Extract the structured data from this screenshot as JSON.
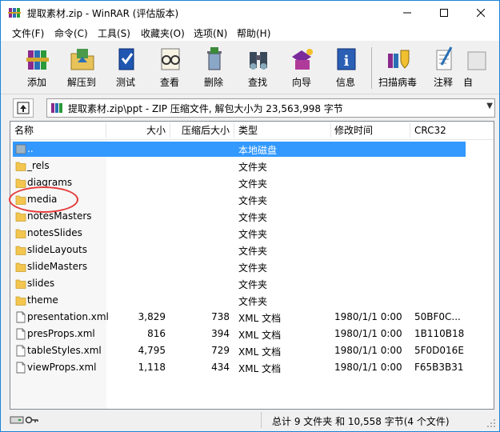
{
  "window": {
    "title": "提取素材.zip - WinRAR (评估版本)"
  },
  "menu": [
    "文件(F)",
    "命令(C)",
    "工具(S)",
    "收藏夹(O)",
    "选项(N)",
    "帮助(H)"
  ],
  "toolbar": [
    {
      "label": "添加",
      "icon": "add-books-icon"
    },
    {
      "label": "解压到",
      "icon": "extract-folder-icon"
    },
    {
      "label": "测试",
      "icon": "test-book-icon"
    },
    {
      "label": "查看",
      "icon": "view-glasses-icon"
    },
    {
      "label": "删除",
      "icon": "delete-trash-icon"
    },
    {
      "label": "查找",
      "icon": "find-binoculars-icon"
    },
    {
      "label": "向导",
      "icon": "wizard-icon"
    },
    {
      "label": "信息",
      "icon": "info-icon"
    },
    {
      "label": "扫描病毒",
      "icon": "scan-virus-icon"
    },
    {
      "label": "注释",
      "icon": "comment-icon"
    },
    {
      "label": "自",
      "icon": "sfx-icon"
    }
  ],
  "address": {
    "path": "提取素材.zip\\ppt - ZIP 压缩文件, 解包大小为 23,563,998 字节"
  },
  "columns": {
    "name": "名称",
    "size": "大小",
    "packed": "压缩后大小",
    "type": "类型",
    "modified": "修改时间",
    "crc": "CRC32"
  },
  "files": [
    {
      "name": "..",
      "size": "",
      "packed": "",
      "type": "本地磁盘",
      "modified": "",
      "crc": "",
      "kind": "drive",
      "selected": true
    },
    {
      "name": "_rels",
      "size": "",
      "packed": "",
      "type": "文件夹",
      "modified": "",
      "crc": "",
      "kind": "folder"
    },
    {
      "name": "diagrams",
      "size": "",
      "packed": "",
      "type": "文件夹",
      "modified": "",
      "crc": "",
      "kind": "folder"
    },
    {
      "name": "media",
      "size": "",
      "packed": "",
      "type": "文件夹",
      "modified": "",
      "crc": "",
      "kind": "folder"
    },
    {
      "name": "notesMasters",
      "size": "",
      "packed": "",
      "type": "文件夹",
      "modified": "",
      "crc": "",
      "kind": "folder"
    },
    {
      "name": "notesSlides",
      "size": "",
      "packed": "",
      "type": "文件夹",
      "modified": "",
      "crc": "",
      "kind": "folder"
    },
    {
      "name": "slideLayouts",
      "size": "",
      "packed": "",
      "type": "文件夹",
      "modified": "",
      "crc": "",
      "kind": "folder"
    },
    {
      "name": "slideMasters",
      "size": "",
      "packed": "",
      "type": "文件夹",
      "modified": "",
      "crc": "",
      "kind": "folder"
    },
    {
      "name": "slides",
      "size": "",
      "packed": "",
      "type": "文件夹",
      "modified": "",
      "crc": "",
      "kind": "folder"
    },
    {
      "name": "theme",
      "size": "",
      "packed": "",
      "type": "文件夹",
      "modified": "",
      "crc": "",
      "kind": "folder"
    },
    {
      "name": "presentation.xml",
      "size": "3,829",
      "packed": "738",
      "type": "XML 文档",
      "modified": "1980/1/1 0:00",
      "crc": "50BF0C...",
      "kind": "file"
    },
    {
      "name": "presProps.xml",
      "size": "816",
      "packed": "394",
      "type": "XML 文档",
      "modified": "1980/1/1 0:00",
      "crc": "1B110B18",
      "kind": "file"
    },
    {
      "name": "tableStyles.xml",
      "size": "4,795",
      "packed": "729",
      "type": "XML 文档",
      "modified": "1980/1/1 0:00",
      "crc": "5F0D016E",
      "kind": "file"
    },
    {
      "name": "viewProps.xml",
      "size": "1,118",
      "packed": "434",
      "type": "XML 文档",
      "modified": "1980/1/1 0:00",
      "crc": "F65B3B31",
      "kind": "file"
    }
  ],
  "status": {
    "summary": "总计 9 文件夹 和 10,558 字节(4 个文件)"
  },
  "colors": {
    "selection": "#3399ff",
    "folder": "#f4c64f",
    "annotation": "#e43a3a",
    "border": "#1883d7"
  }
}
